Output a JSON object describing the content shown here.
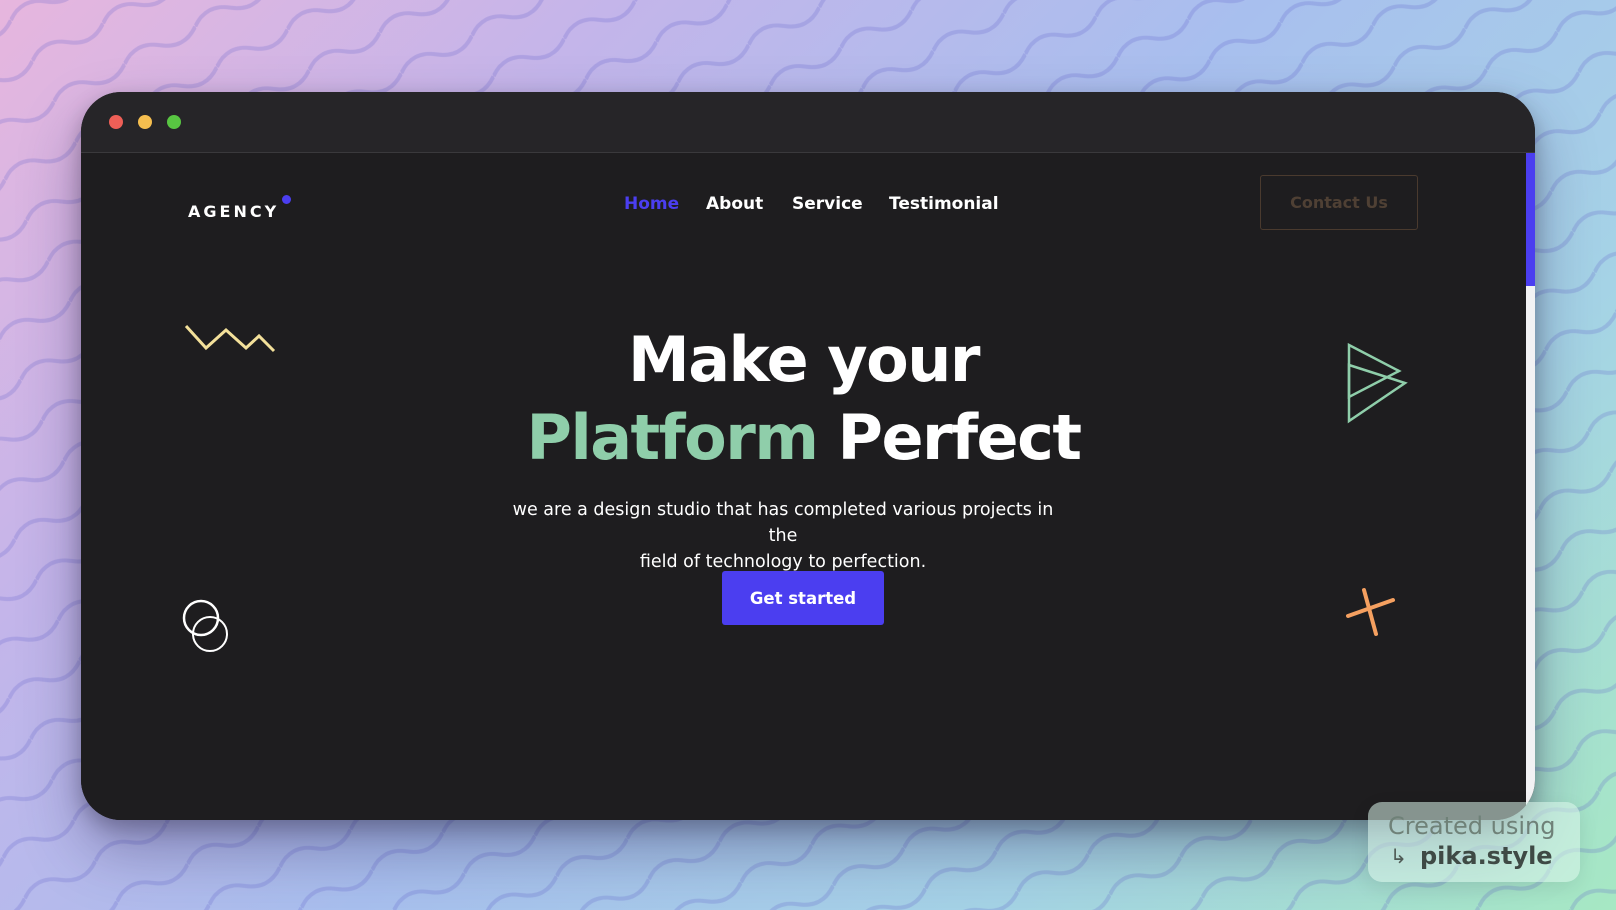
{
  "colors": {
    "accent": "#4b3ef0",
    "highlight": "#8fceaa",
    "page_bg": "#1e1d1f",
    "contact_border": "#4a3a2e",
    "deco_yellow": "#f3e09a",
    "deco_green": "#8fceaa",
    "deco_orange": "#f5a060"
  },
  "browser": {
    "controls": [
      "close",
      "minimize",
      "zoom"
    ]
  },
  "header": {
    "logo": "AGENCY",
    "nav": [
      {
        "label": "Home",
        "active": true
      },
      {
        "label": "About",
        "active": false
      },
      {
        "label": "Service",
        "active": false
      },
      {
        "label": "Testimonial",
        "active": false
      }
    ],
    "contact_label": "Contact Us"
  },
  "hero": {
    "line1": "Make your",
    "line2_accent": "Platform",
    "line2_rest": "Perfect",
    "subtitle_line1": "we are a design studio that has completed various projects in the",
    "subtitle_line2": "field of technology to perfection.",
    "cta_label": "Get started"
  },
  "decorations": [
    "zigzag-icon",
    "play-triangles-icon",
    "circles-icon",
    "cross-icon"
  ],
  "badge": {
    "line1": "Created using",
    "arrow": "↳",
    "line2": "pika.style"
  }
}
